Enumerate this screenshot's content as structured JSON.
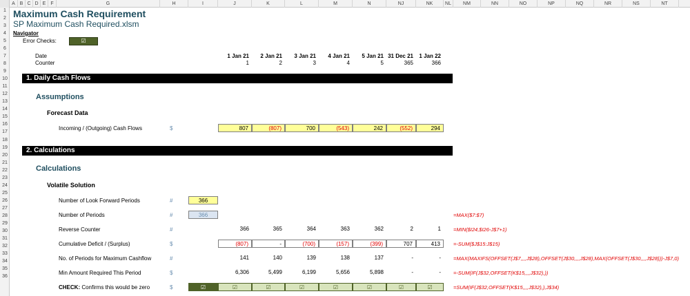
{
  "columns": [
    "A",
    "B",
    "C",
    "D",
    "E",
    "F",
    "G",
    "H",
    "I",
    "J",
    "K",
    "L",
    "M",
    "N",
    "NJ",
    "NK",
    "NL",
    "NM",
    "NN",
    "NO",
    "NP",
    "NQ",
    "NR",
    "NS",
    "NT"
  ],
  "rows": [
    "1",
    "2",
    "3",
    "4",
    "5",
    "6",
    "7",
    "8",
    "9",
    "10",
    "11",
    "12",
    "13",
    "14",
    "15",
    "16",
    "17",
    "18",
    "19",
    "20",
    "21",
    "22",
    "23",
    "24",
    "25",
    "26",
    "27",
    "28",
    "29",
    "30",
    "31",
    "32",
    "33",
    "34",
    "35",
    "36"
  ],
  "title": "Maximum Cash Requirement",
  "subtitle": "SP Maximum Cash Required.xlsm",
  "navigator": "Navigator",
  "error_checks": {
    "label": "Error Checks:",
    "value": "☑"
  },
  "header": {
    "date_label": "Date",
    "counter_label": "Counter",
    "dates": [
      "1 Jan 21",
      "2 Jan 21",
      "3 Jan 21",
      "4 Jan 21",
      "5 Jan 21",
      "31 Dec 21",
      "1 Jan 22"
    ],
    "counters": [
      "1",
      "2",
      "3",
      "4",
      "5",
      "365",
      "366"
    ]
  },
  "section1": {
    "bar": "1.  Daily Cash Flows",
    "h2": "Assumptions",
    "h3": "Forecast Data",
    "flows_label": "Incoming / (Outgoing) Cash Flows",
    "flows_unit": "$",
    "flows": [
      "807",
      "(807)",
      "700",
      "(543)",
      "242",
      "(552)",
      "294"
    ]
  },
  "section2": {
    "bar": "2.  Calculations",
    "h2": "Calculations",
    "h3": "Volatile Solution",
    "look_forward": {
      "label": "Number of Look Forward Periods",
      "unit": "#",
      "value": "366"
    },
    "periods": {
      "label": "Number of Periods",
      "unit": "#",
      "value": "366",
      "formula": "=MAX($7:$7)"
    },
    "reverse": {
      "label": "Reverse Counter",
      "unit": "#",
      "values": [
        "366",
        "365",
        "364",
        "363",
        "362",
        "2",
        "1"
      ],
      "formula": "=MIN($I24,$I26-J$7+1)"
    },
    "cumulative": {
      "label": "Cumulative Deficit / (Surplus)",
      "unit": "$",
      "values": [
        "(807)",
        "-",
        "(700)",
        "(157)",
        "(399)",
        "707",
        "413"
      ],
      "formula": "=-SUM($J$15:J$15)"
    },
    "periods_max": {
      "label": "No. of Periods for Maximum Cashflow",
      "unit": "#",
      "values": [
        "141",
        "140",
        "139",
        "138",
        "137",
        "-",
        "-"
      ],
      "formula": "=MAX(MAXIFS(OFFSET(J$7,,,,J$28),OFFSET(J$30,,,,J$28),MAX(OFFSET(J$30,,,,J$28)))-J$7,0)"
    },
    "min_amount": {
      "label": "Min Amount Required This Period",
      "unit": "$",
      "values": [
        "6,306",
        "5,499",
        "6,199",
        "5,656",
        "5,898",
        "-",
        "-"
      ],
      "formula": "=-SUM(IF(J$32,OFFSET(K$15,,,,J$32),))"
    },
    "check": {
      "label_bold": "CHECK:",
      "label_rest": " Confirms this would be zero",
      "unit": "$",
      "first": "☑",
      "values": [
        "☑",
        "☑",
        "☑",
        "☑",
        "☑",
        "☑",
        "☑"
      ],
      "formula": "=SUM(IF(J$32,OFFSET(K$15,,,,J$32),),J$34)"
    }
  },
  "colors": {
    "header_blue": "#1f4e5f",
    "negative_red": "#e00000",
    "input_yellow": "#ffff99",
    "check_green": "#4f6228"
  }
}
